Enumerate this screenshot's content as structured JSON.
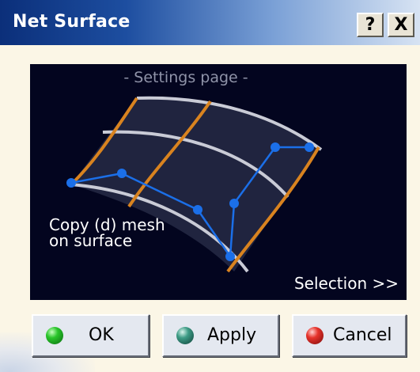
{
  "window": {
    "title": "Net Surface"
  },
  "titlebar_buttons": {
    "help": "?",
    "close": "X"
  },
  "illustration": {
    "heading": "- Settings page -",
    "caption_line1": "Copy (d) mesh",
    "caption_line2": "on surface",
    "selection_link": "Selection >>",
    "colors": {
      "background": "#03051f",
      "guide_curves": "#d9831f",
      "profile_curves": "#c9cbd6",
      "mesh_polyline": "#1b6fe8"
    }
  },
  "buttons": {
    "ok": {
      "label": "OK",
      "icon": "green-orb-icon"
    },
    "apply": {
      "label": "Apply",
      "icon": "teal-orb-icon"
    },
    "cancel": {
      "label": "Cancel",
      "icon": "red-orb-icon"
    }
  }
}
